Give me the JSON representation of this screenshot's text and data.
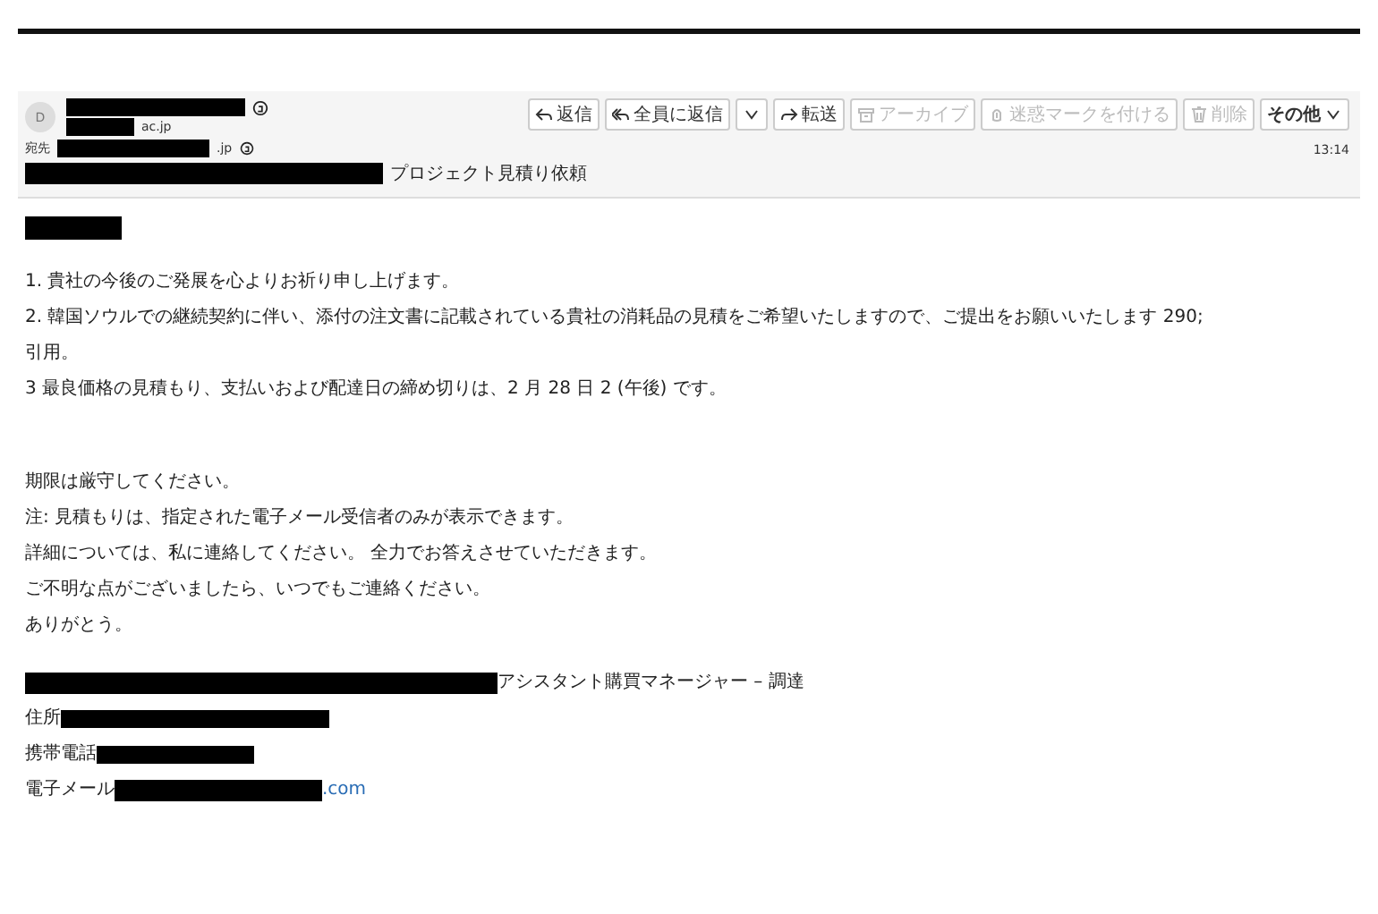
{
  "message": {
    "avatar": "D",
    "from": {
      "name": [
        {
          "kind": "redacted"
        }
      ],
      "address": [
        {
          "kind": "redacted"
        },
        {
          "kind": "text",
          "text": "ac.jp"
        }
      ]
    },
    "to": {
      "label": "宛先",
      "address": [
        {
          "kind": "redacted"
        },
        {
          "kind": "text",
          "text": ".jp"
        }
      ]
    },
    "subject": [
      {
        "kind": "redacted"
      },
      {
        "kind": "text",
        "text": "プロジェクト見積り依頼"
      }
    ],
    "time": "13:14",
    "actions": [
      {
        "kind": "reply",
        "label": "返信",
        "disabled": false
      },
      {
        "kind": "replyall",
        "label": "全員に返信",
        "disabled": false
      },
      {
        "kind": "caret",
        "disabled": false
      },
      {
        "kind": "forward",
        "label": "転送",
        "disabled": false
      },
      {
        "kind": "archive",
        "label": "アーカイブ",
        "disabled": true
      },
      {
        "kind": "spam",
        "label": "迷惑マークを付ける",
        "disabled": true
      },
      {
        "kind": "trash",
        "label": "削除",
        "disabled": true
      },
      {
        "kind": "menu",
        "label": "その他",
        "disabled": false
      }
    ],
    "body": [
      [
        [
          {
            "kind": "redacted"
          }
        ]
      ],
      [
        [
          {
            "kind": "text",
            "text": "1. 貴社の今後のご発展を心よりお祈り申し上げます。"
          }
        ],
        [
          {
            "kind": "text",
            "text": "2. 韓国ソウルでの継続契約に伴い、添付の注文書に記載されている貴社の消耗品の見積をご希望いたしますので、ご提出をお願いいたします 290;"
          }
        ],
        [
          {
            "kind": "text",
            "text": "引用。"
          }
        ],
        [
          {
            "kind": "text",
            "text": "3 最良価格の見積もり、支払いおよび配達日の締め切りは、2 月 28 日 2 (午後) です。"
          }
        ]
      ],
      [
        [
          {
            "kind": "text",
            "text": "期限は厳守してください。"
          }
        ],
        [
          {
            "kind": "text",
            "text": "注: 見積もりは、指定された電子メール受信者のみが表示できます。"
          }
        ],
        [
          {
            "kind": "text",
            "text": "詳細については、私に連絡してください。 全力でお答えさせていただきます。"
          }
        ],
        [
          {
            "kind": "text",
            "text": "ご不明な点がございましたら、いつでもご連絡ください。"
          }
        ],
        [
          {
            "kind": "text",
            "text": "ありがとう。"
          }
        ]
      ],
      [
        [
          {
            "kind": "redacted"
          },
          {
            "kind": "text",
            "text": "アシスタント購買マネージャー – 調達"
          }
        ],
        [
          {
            "kind": "text",
            "text": "住所 "
          },
          {
            "kind": "redacted"
          }
        ],
        [
          {
            "kind": "text",
            "text": "携帯電話 "
          },
          {
            "kind": "redacted"
          }
        ],
        [
          {
            "kind": "text",
            "text": "電子メール"
          },
          {
            "kind": "redacted"
          },
          {
            "kind": "link",
            "text": ".com"
          }
        ]
      ]
    ]
  }
}
